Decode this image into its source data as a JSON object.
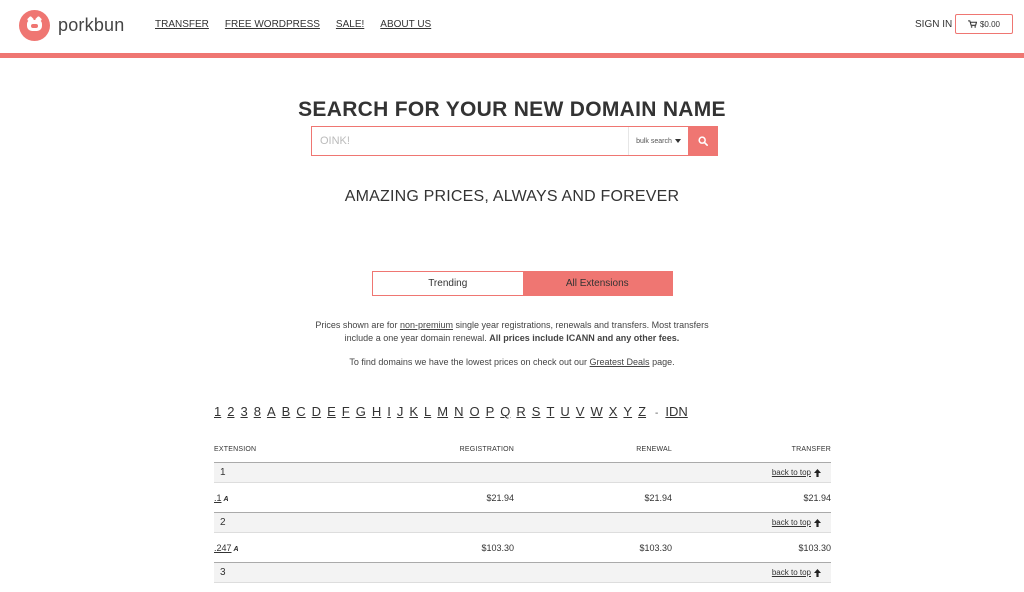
{
  "brand": {
    "name": "porkbun",
    "accent": "#ef7672"
  },
  "nav": {
    "items": [
      "TRANSFER",
      "FREE WORDPRESS",
      "SALE!",
      "ABOUT US"
    ],
    "signin": "SIGN IN",
    "cart": "$0.00"
  },
  "search": {
    "title": "SEARCH FOR YOUR NEW DOMAIN NAME",
    "placeholder": "OINK!",
    "bulk_label": "bulk search",
    "button_icon": "search-icon"
  },
  "tagline": "AMAZING PRICES, ALWAYS AND FOREVER",
  "tabs": [
    {
      "label": "Trending",
      "active": false
    },
    {
      "label": "All Extensions",
      "active": true
    }
  ],
  "note": {
    "p1_a": "Prices shown are for ",
    "p1_link": "non-premium",
    "p1_b": " single year registrations, renewals and transfers. Most transfers include a one year domain renewal. ",
    "p1_bold": "All prices include ICANN and any other fees.",
    "p2_a": "To find domains we have the lowest prices on check out our ",
    "p2_link": "Greatest Deals",
    "p2_b": " page."
  },
  "alphabet": [
    "1",
    "2",
    "3",
    "8",
    "A",
    "B",
    "C",
    "D",
    "E",
    "F",
    "G",
    "H",
    "I",
    "J",
    "K",
    "L",
    "M",
    "N",
    "O",
    "P",
    "Q",
    "R",
    "S",
    "T",
    "U",
    "V",
    "W",
    "X",
    "Y",
    "Z"
  ],
  "alphabet_sep": "-",
  "alphabet_idn": "IDN",
  "table": {
    "headers": {
      "extension": "EXTENSION",
      "registration": "REGISTRATION",
      "renewal": "RENEWAL",
      "transfer": "TRANSFER"
    },
    "back_to_top": "back to top",
    "groups": [
      {
        "label": "1",
        "rows": [
          {
            "ext": ".1",
            "badge": "A",
            "registration": "$21.94",
            "renewal": "$21.94",
            "transfer": "$21.94"
          }
        ]
      },
      {
        "label": "2",
        "rows": [
          {
            "ext": ".247",
            "badge": "A",
            "registration": "$103.30",
            "renewal": "$103.30",
            "transfer": "$103.30"
          }
        ]
      },
      {
        "label": "3",
        "rows": []
      }
    ]
  }
}
